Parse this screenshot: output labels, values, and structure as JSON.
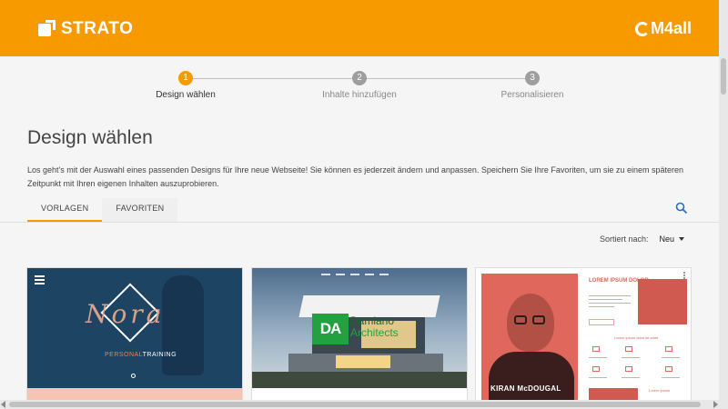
{
  "header": {
    "brand": "STRATO",
    "partner": "M4all",
    "background_color": "#f79a00"
  },
  "stepper": {
    "steps": [
      {
        "number": "1",
        "label": "Design wählen",
        "active": true
      },
      {
        "number": "2",
        "label": "Inhalte hinzufügen",
        "active": false
      },
      {
        "number": "3",
        "label": "Personalisieren",
        "active": false
      }
    ]
  },
  "main": {
    "title": "Design wählen",
    "intro": "Los geht's mit der Auswahl eines passenden Designs für Ihre neue Webseite! Sie können es jederzeit ändern und anpassen. Speichern Sie Ihre Favoriten, um sie zu einem späteren Zeitpunkt mit Ihren eigenen Inhalten auszuprobieren.",
    "tabs": [
      {
        "label": "VORLAGEN",
        "active": true
      },
      {
        "label": "FAVORITEN",
        "active": false
      }
    ],
    "search_icon": "search-icon",
    "sort": {
      "label": "Sortiert nach:",
      "value": "Neu"
    }
  },
  "cards": [
    {
      "caption_accent": "PERSONAL",
      "caption_rest": "TRAINING",
      "script_text": "Nora"
    },
    {
      "badge": "DA",
      "name_line1": "Damiano",
      "name_line2": "Architects"
    },
    {
      "heading": "LOREM IPSUM DOLOR",
      "subheading": "Lorem ipsum dolor sit amet",
      "person_name": "KIRAN McDOUGAL",
      "section_title": "Lorem ipsum"
    }
  ]
}
